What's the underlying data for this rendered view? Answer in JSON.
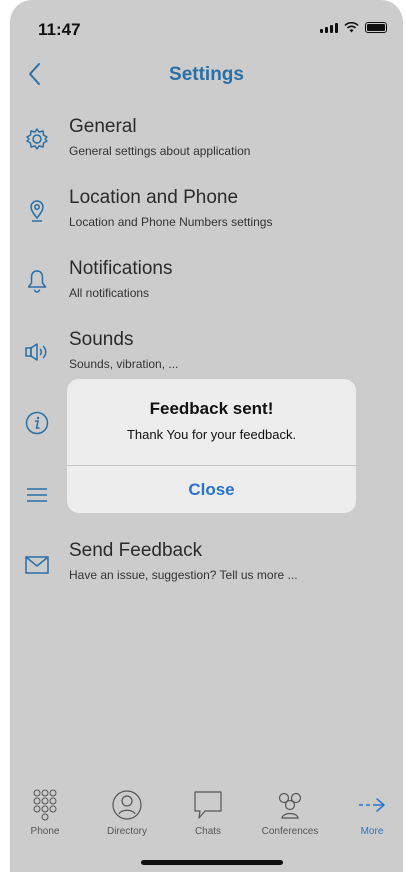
{
  "status_bar": {
    "time": "11:47"
  },
  "nav": {
    "title": "Settings",
    "back_icon": "chevron-left-icon"
  },
  "settings": [
    {
      "title": "General",
      "subtitle": "General settings about application",
      "icon": "gear-icon"
    },
    {
      "title": "Location and Phone",
      "subtitle": "Location and Phone Numbers settings",
      "icon": "location-pin-icon"
    },
    {
      "title": "Notifications",
      "subtitle": "All notifications",
      "icon": "bell-icon"
    },
    {
      "title": "Sounds",
      "subtitle": "Sounds, vibration, ...",
      "icon": "speaker-icon"
    },
    {
      "title": "",
      "subtitle": "",
      "icon": "info-icon"
    },
    {
      "title": "",
      "subtitle": "",
      "icon": "menu-icon"
    },
    {
      "title": "Send Feedback",
      "subtitle": "Have an issue, suggestion? Tell us more ...",
      "icon": "envelope-icon"
    }
  ],
  "dialog": {
    "title": "Feedback sent!",
    "message": "Thank You for your feedback.",
    "button": "Close"
  },
  "tabs": [
    {
      "label": "Phone",
      "icon": "dialpad-icon"
    },
    {
      "label": "Directory",
      "icon": "contact-icon"
    },
    {
      "label": "Chats",
      "icon": "chat-bubble-icon"
    },
    {
      "label": "Conferences",
      "icon": "group-icon"
    },
    {
      "label": "More",
      "icon": "arrow-right-icon",
      "active": true
    }
  ],
  "colors": {
    "accent": "#2a73c9",
    "title": "#2a6fa6",
    "overlay": "#cccccc",
    "dialog": "#ededed"
  }
}
